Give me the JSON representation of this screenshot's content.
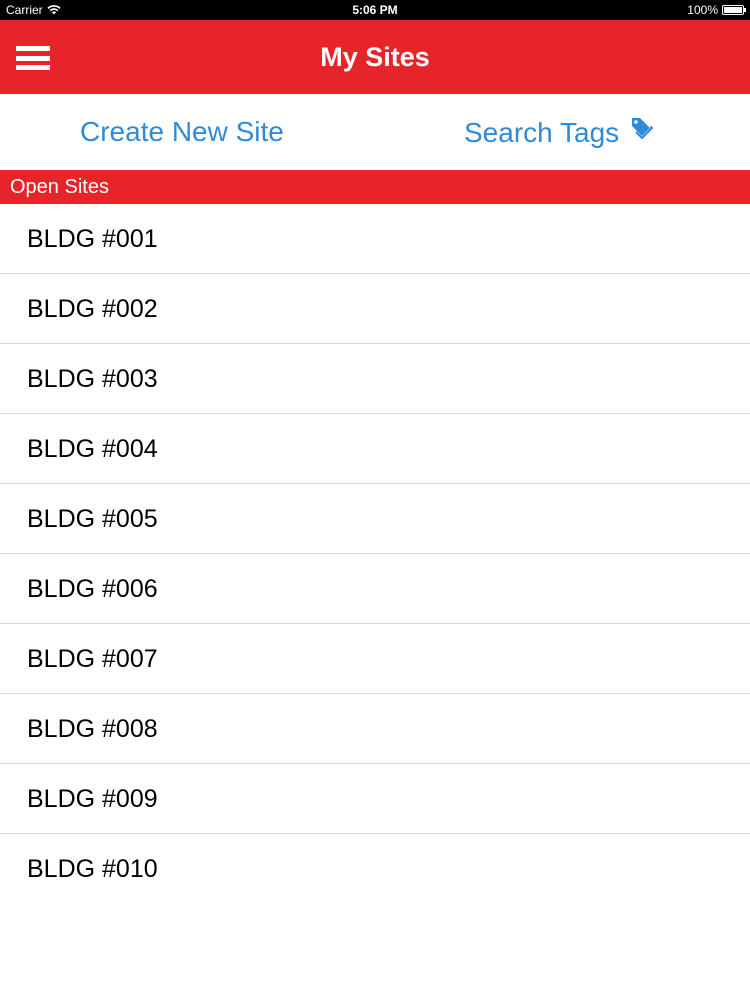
{
  "status_bar": {
    "carrier": "Carrier",
    "time": "5:06 PM",
    "battery_text": "100%",
    "battery_level": 1.0
  },
  "nav": {
    "title": "My Sites",
    "menu_icon": "hamburger-menu-icon"
  },
  "actions": {
    "create_label": "Create New Site",
    "search_label": "Search Tags",
    "search_icon": "tag-icon"
  },
  "section": {
    "title": "Open Sites"
  },
  "sites": [
    "BLDG #001",
    "BLDG #002",
    "BLDG #003",
    "BLDG #004",
    "BLDG #005",
    "BLDG #006",
    "BLDG #007",
    "BLDG #008",
    "BLDG #009",
    "BLDG #010"
  ],
  "colors": {
    "brand_red": "#e8242b",
    "link_blue": "#2f8ad9"
  }
}
